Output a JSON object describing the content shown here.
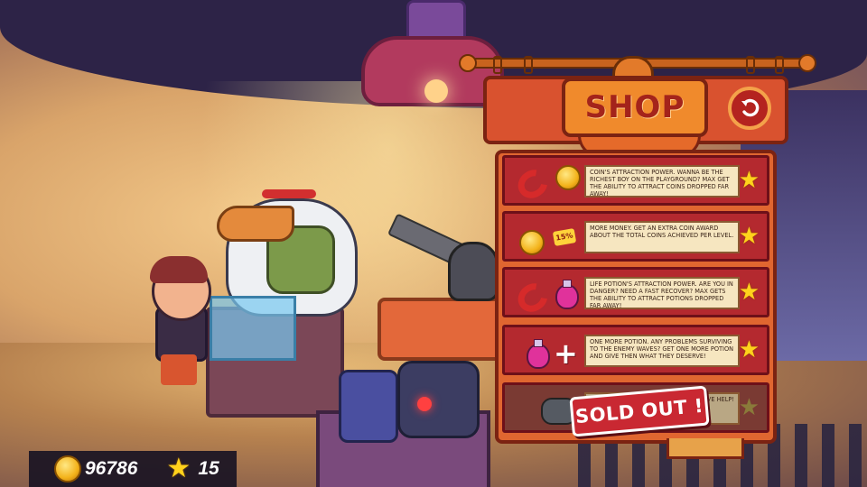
{
  "shop": {
    "title": "SHOP",
    "back_icon": "back-arrow-icon",
    "items": [
      {
        "icons": [
          "magnet-icon",
          "coin-icon"
        ],
        "description": "Coin's attraction power. Wanna be the richest boy on the playground? Max get the ability to attract coins dropped far away!",
        "rating": "★",
        "sold_out": false
      },
      {
        "icons": [
          "coin-icon",
          "percent-burst-icon"
        ],
        "badge": "15%",
        "description": "More money. Get an extra coin award about the total coins achieved per level.",
        "rating": "★",
        "sold_out": false
      },
      {
        "icons": [
          "magnet-icon",
          "potion-icon"
        ],
        "description": "Life potion's attraction power. Are you in danger? Need a fast recover? Max gets the ability to attract potions dropped far away!",
        "rating": "★",
        "sold_out": false
      },
      {
        "icons": [
          "potion-icon",
          "plus-icon"
        ],
        "plus": "+",
        "description": "One more potion. Any problems surviving to the enemy waves? Get one more potion and give then what they deserve!",
        "rating": "★",
        "sold_out": false
      },
      {
        "icons": [
          "grenade-icon"
        ],
        "description": "left, Mr ve help!",
        "rating": "★",
        "sold_out": true,
        "sold_out_label": "SOLD OUT !"
      }
    ]
  },
  "hud": {
    "coins": "96786",
    "stars": "15",
    "star_glyph": "★"
  },
  "colors": {
    "panel_orange": "#e06630",
    "item_red": "#b4292f",
    "title_red": "#a4241b",
    "star_yellow": "#ffd21c"
  }
}
